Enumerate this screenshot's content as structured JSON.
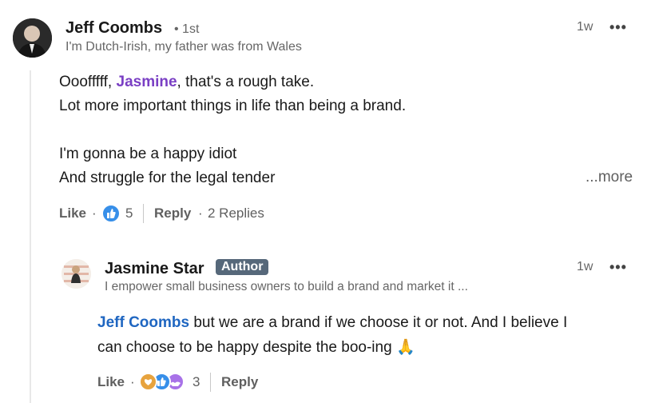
{
  "comment": {
    "author": "Jeff Coombs",
    "degree": "• 1st",
    "headline": "I'm Dutch-Irish, my father was from Wales",
    "time": "1w",
    "menu_icon": "more-horizontal-icon",
    "body": {
      "line1_prefix": "Ooofffff, ",
      "line1_mention": "Jasmine",
      "line1_suffix": ", that's a rough take.",
      "line2": "Lot more important things in life than being a brand.",
      "line3": "I'm gonna be a happy idiot",
      "line4": "And struggle for the legal tender"
    },
    "more_label": "...more",
    "actions": {
      "like_label": "Like",
      "sep": "·",
      "reaction_count": "5",
      "reply_label": "Reply",
      "replies_label": "2 Replies"
    }
  },
  "reply": {
    "author": "Jasmine Star",
    "badge": "Author",
    "headline": "I empower small business owners to build a brand and market it ...",
    "time": "1w",
    "menu_icon": "more-horizontal-icon",
    "body": {
      "mention": "Jeff Coombs",
      "line1_suffix": " but we are a brand if we choose it or not. And I believe I",
      "line2": "can choose to be happy despite the boo-ing",
      "emoji": "🙏"
    },
    "actions": {
      "like_label": "Like",
      "sep": "·",
      "reaction_count": "3",
      "reply_label": "Reply"
    }
  },
  "colors": {
    "mention_purple": "#7a3fc4",
    "mention_blue": "#1f66c1",
    "author_badge": "#56687a",
    "like_blue": "#378fe9",
    "celebrate_orange": "#e7a33e",
    "support_purple": "#a872e8"
  }
}
